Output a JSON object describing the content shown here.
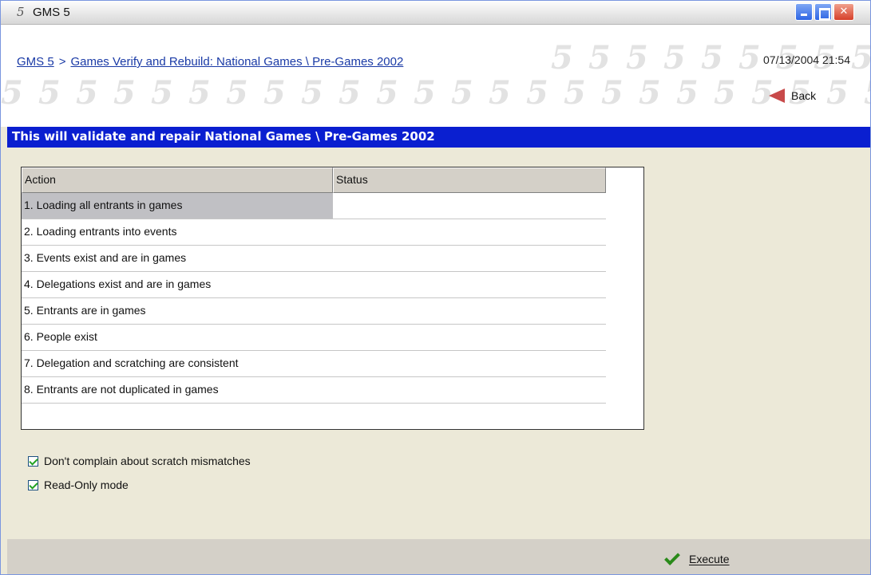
{
  "window": {
    "logo": "5",
    "title": "GMS 5"
  },
  "header": {
    "breadcrumb_root": "GMS 5",
    "breadcrumb_sep": ">",
    "breadcrumb_page": "Games Verify and Rebuild: National Games \\ Pre-Games 2002",
    "datetime": "07/13/2004 21:54",
    "back_label": "Back",
    "watermark_glyph": "5"
  },
  "banner": {
    "text": "This will validate and repair National Games \\ Pre-Games 2002"
  },
  "grid": {
    "columns": [
      "Action",
      "Status"
    ],
    "rows": [
      {
        "action": "1. Loading all entrants in games",
        "status": ""
      },
      {
        "action": "2. Loading entrants into events",
        "status": ""
      },
      {
        "action": "3. Events exist and are in games",
        "status": ""
      },
      {
        "action": "4. Delegations exist and are in games",
        "status": ""
      },
      {
        "action": "5. Entrants are in games",
        "status": ""
      },
      {
        "action": "6. People exist",
        "status": ""
      },
      {
        "action": "7. Delegation and scratching are consistent",
        "status": ""
      },
      {
        "action": "8. Entrants are not duplicated in games",
        "status": ""
      }
    ],
    "selected_row": 0
  },
  "options": {
    "scratch_label": "Don't complain about scratch mismatches",
    "scratch_checked": true,
    "readonly_label": "Read-Only mode",
    "readonly_checked": true
  },
  "footer": {
    "execute_label": "Execute"
  },
  "colors": {
    "banner": "#0a1fd0",
    "link": "#1a3aa6",
    "back_arrow": "#c84a4a",
    "execute_check": "#2a8a1a"
  }
}
